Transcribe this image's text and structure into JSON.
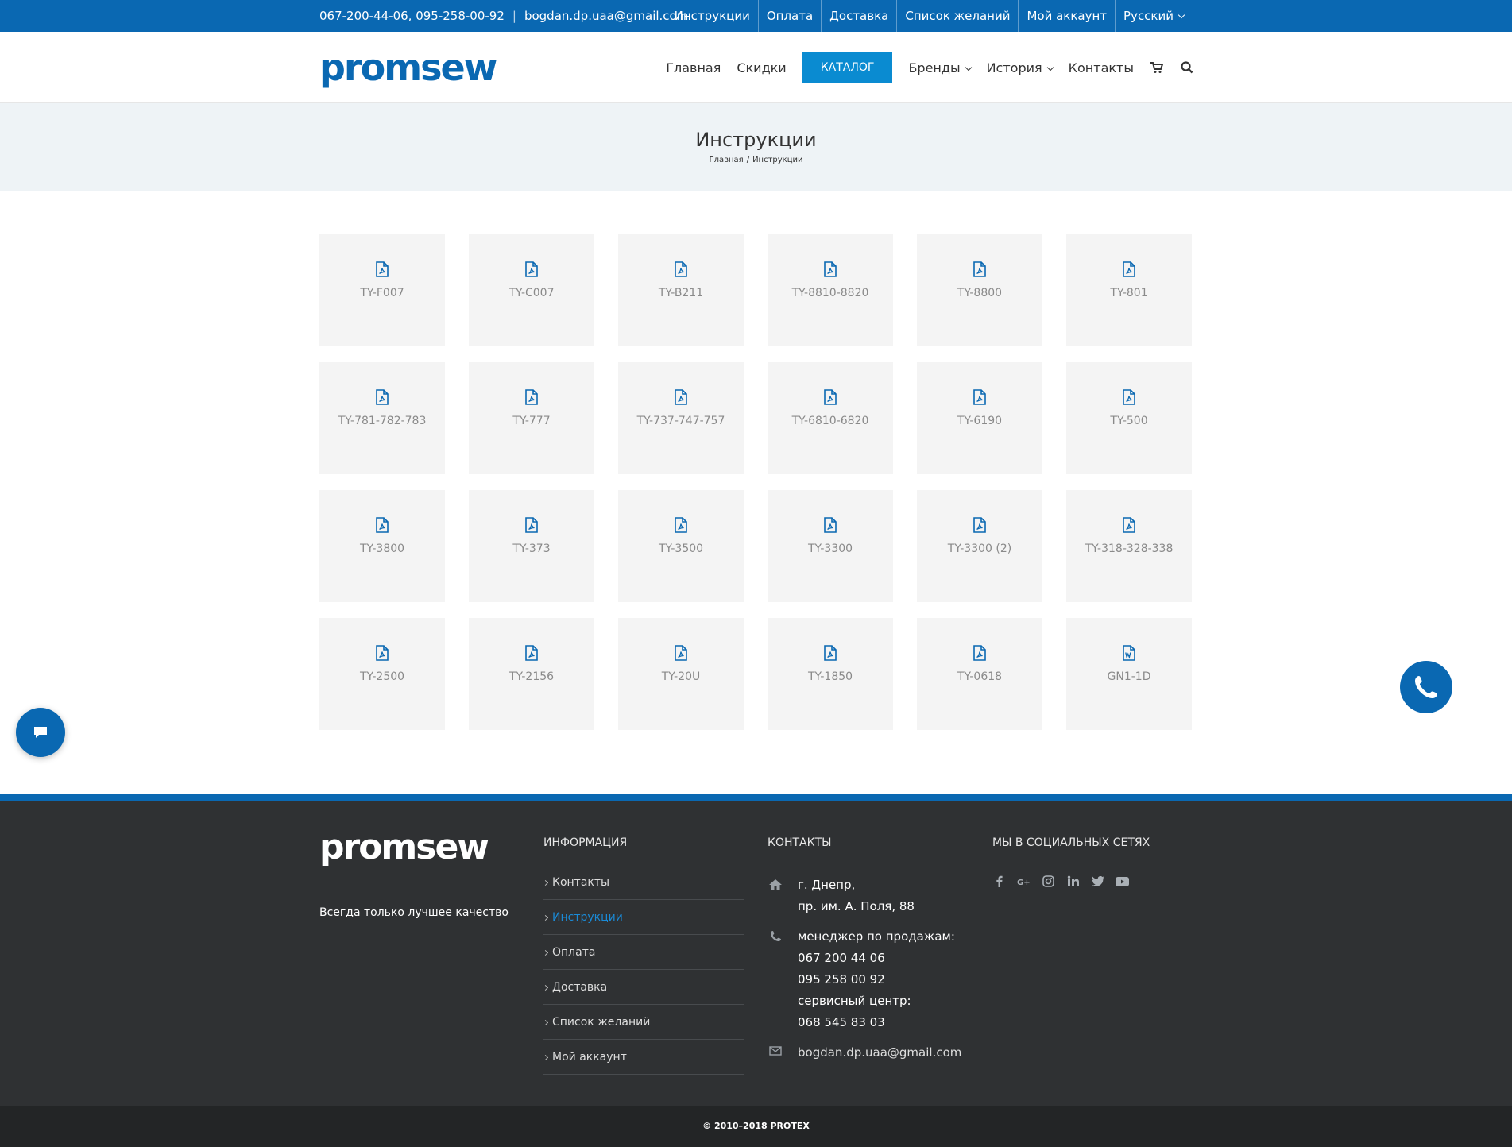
{
  "topbar": {
    "phones": "067-200-44-06, 095-258-00-92",
    "email": "bogdan.dp.uaa@gmail.com",
    "menu": [
      "Инструкции",
      "Оплата",
      "Доставка",
      "Список желаний",
      "Мой аккаунт"
    ],
    "language": "Русский"
  },
  "header": {
    "logo": "promsew",
    "nav": {
      "home": "Главная",
      "sales": "Скидки",
      "catalog": "КАТАЛОГ",
      "brands": "Бренды",
      "history": "История",
      "contacts": "Контакты"
    }
  },
  "page": {
    "title": "Инструкции",
    "breadcrumb_home": "Главная",
    "breadcrumb_sep": "/",
    "breadcrumb_current": "Инструкции"
  },
  "documents": [
    {
      "name": "TY-F007",
      "icon": "pdf-icon"
    },
    {
      "name": "TY-C007",
      "icon": "pdf-icon"
    },
    {
      "name": "TY-B211",
      "icon": "pdf-icon"
    },
    {
      "name": "TY-8810-8820",
      "icon": "pdf-icon"
    },
    {
      "name": "TY-8800",
      "icon": "pdf-icon"
    },
    {
      "name": "TY-801",
      "icon": "pdf-icon"
    },
    {
      "name": "TY-781-782-783",
      "icon": "pdf-icon"
    },
    {
      "name": "TY-777",
      "icon": "pdf-icon"
    },
    {
      "name": "TY-737-747-757",
      "icon": "pdf-icon"
    },
    {
      "name": "TY-6810-6820",
      "icon": "pdf-icon"
    },
    {
      "name": "TY-6190",
      "icon": "pdf-icon"
    },
    {
      "name": "TY-500",
      "icon": "pdf-icon"
    },
    {
      "name": "TY-3800",
      "icon": "pdf-icon"
    },
    {
      "name": "TY-373",
      "icon": "pdf-icon"
    },
    {
      "name": "TY-3500",
      "icon": "pdf-icon"
    },
    {
      "name": "TY-3300",
      "icon": "pdf-icon"
    },
    {
      "name": "TY-3300 (2)",
      "icon": "pdf-icon"
    },
    {
      "name": "TY-318-328-338",
      "icon": "pdf-icon"
    },
    {
      "name": "TY-2500",
      "icon": "pdf-icon"
    },
    {
      "name": "TY-2156",
      "icon": "pdf-icon"
    },
    {
      "name": "TY-20U",
      "icon": "pdf-icon"
    },
    {
      "name": "TY-1850",
      "icon": "pdf-icon"
    },
    {
      "name": "TY-0618",
      "icon": "pdf-icon"
    },
    {
      "name": "GN1-1D",
      "icon": "word-icon"
    }
  ],
  "footer": {
    "logo": "promsew",
    "tagline": "Всегда только лучшее качество",
    "info_heading": "ИНФОРМАЦИЯ",
    "info_links": [
      "Контакты",
      "Инструкции",
      "Оплата",
      "Доставка",
      "Список желаний",
      "Мой аккаунт"
    ],
    "contacts_heading": "КОНТАКТЫ",
    "address_line1": "г. Днепр,",
    "address_line2": "пр. им. А. Поля, 88",
    "phone_label": "менеджер по продажам:",
    "phone1": "067 200 44 06",
    "phone2": "095 258 00 92",
    "service_label": "сервисный центр:",
    "service_phone": "068 545 83 03",
    "email": "bogdan.dp.uaa@gmail.com",
    "social_heading": "МЫ В СОЦИАЛЬНЫХ СЕТЯХ",
    "social_icons": [
      "facebook-icon",
      "google-plus-icon",
      "instagram-icon",
      "linkedin-icon",
      "twitter-icon",
      "youtube-icon"
    ],
    "copyright": "© 2010–2018 PROTEX"
  },
  "colors": {
    "brand_blue": "#0a68b2",
    "catalog_blue": "#0a8bd1",
    "footer_bg": "#2f3133",
    "card_bg": "#f4f4f4",
    "title_bar_bg": "#eef3f6"
  }
}
